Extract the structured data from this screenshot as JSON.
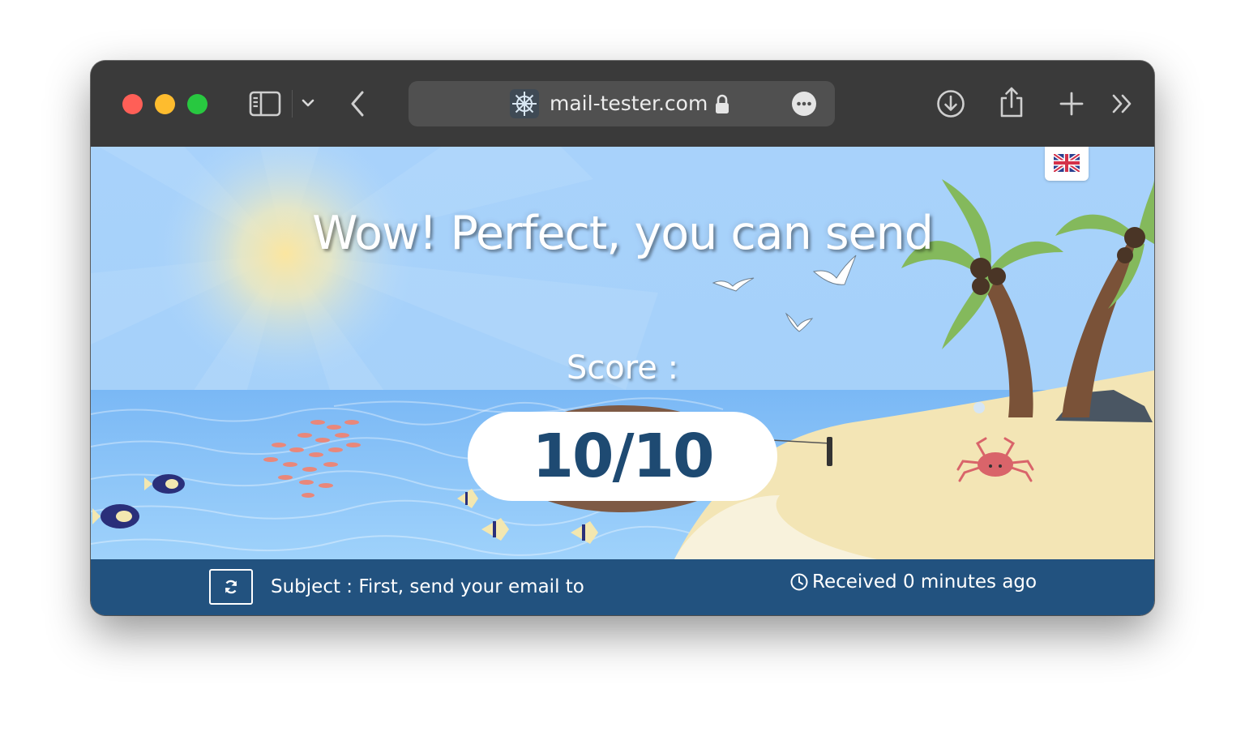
{
  "browser": {
    "url": "mail-tester.com",
    "colors": {
      "chrome": "#3a3a3a",
      "address_bar": "#505050"
    },
    "icons": [
      "sidebar-icon",
      "chevron-down-icon",
      "back-icon",
      "site-helm-icon",
      "lock-icon",
      "more-icon",
      "download-icon",
      "share-icon",
      "plus-icon",
      "double-chevron-icon"
    ]
  },
  "page": {
    "headline": "Wow! Perfect, you can send",
    "score_label": "Score :",
    "score_value": "10/10",
    "language_flag": "uk-flag-icon",
    "colors": {
      "score_text": "#1e4a72",
      "status_bar": "#22527f"
    }
  },
  "status": {
    "subject": "Subject : First, send your email to",
    "received": "Received 0 minutes ago"
  }
}
